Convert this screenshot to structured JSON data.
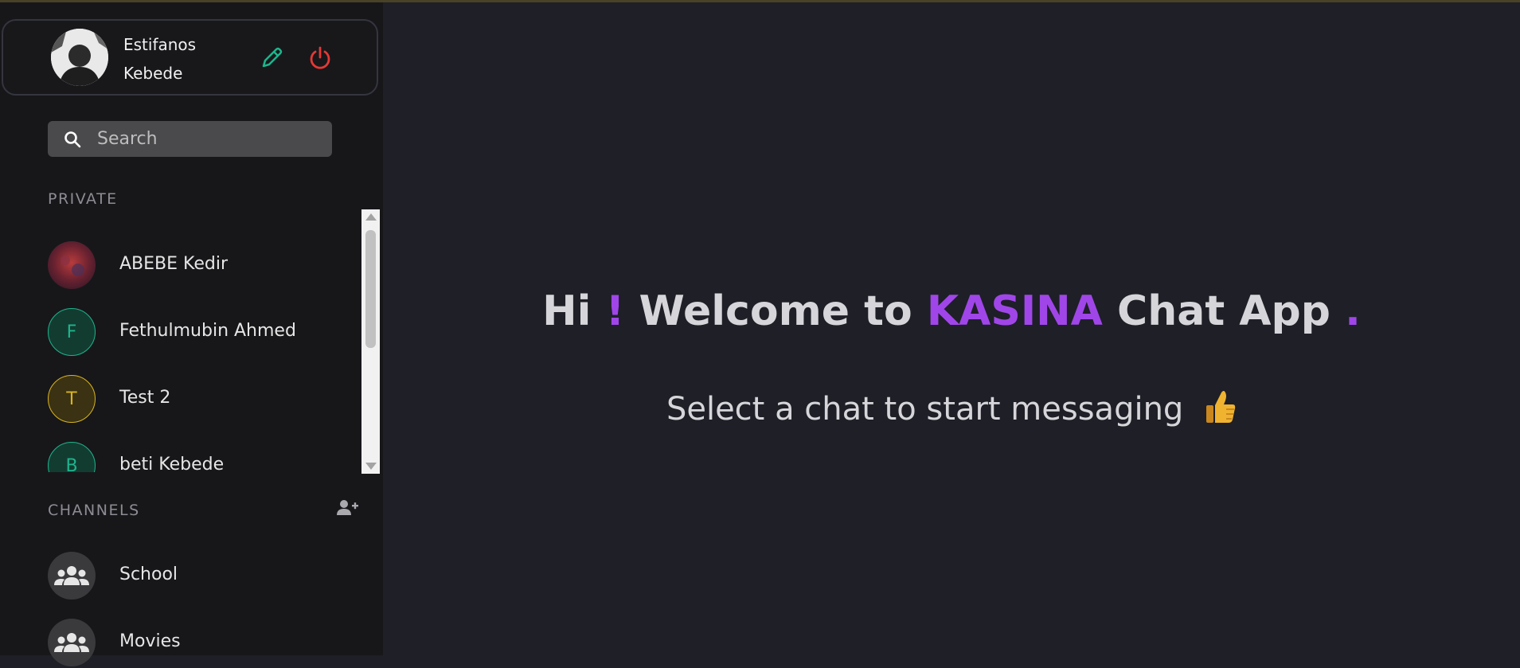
{
  "user": {
    "name_line1": "Estifanos",
    "name_line2": "Kebede",
    "avatar_icon": "user-photo",
    "edit_icon": "pencil-icon",
    "logout_icon": "power-icon"
  },
  "search": {
    "placeholder": "Search",
    "icon": "search-icon"
  },
  "private": {
    "label": "PRIVATE",
    "contacts": [
      {
        "name": "ABEBE Kedir",
        "initial": "",
        "avatar": "photo"
      },
      {
        "name": "Fethulmubin Ahmed",
        "initial": "F",
        "color": "#1db58c"
      },
      {
        "name": "Test 2",
        "initial": "T",
        "color": "#d9b421"
      },
      {
        "name": "beti Kebede",
        "initial": "B",
        "color": "#1db58c"
      }
    ]
  },
  "channels": {
    "label": "CHANNELS",
    "add_icon": "add-user-icon",
    "items": [
      {
        "name": "School",
        "icon": "group-icon"
      },
      {
        "name": "Movies",
        "icon": "group-icon"
      }
    ]
  },
  "main": {
    "greeting_hi": "Hi",
    "greeting_bang": "!",
    "greeting_welcome": "Welcome to",
    "greeting_brand": "KASINA",
    "greeting_app": "Chat App",
    "greeting_dot": ".",
    "subtitle": "Select a chat to start messaging",
    "subtitle_icon": "thumbs-up-icon"
  },
  "colors": {
    "accent": "#a046e8",
    "sidebar_bg": "#17171a",
    "main_bg": "#1e1f27",
    "edit_green": "#1db58c",
    "logout_red": "#e53935"
  }
}
